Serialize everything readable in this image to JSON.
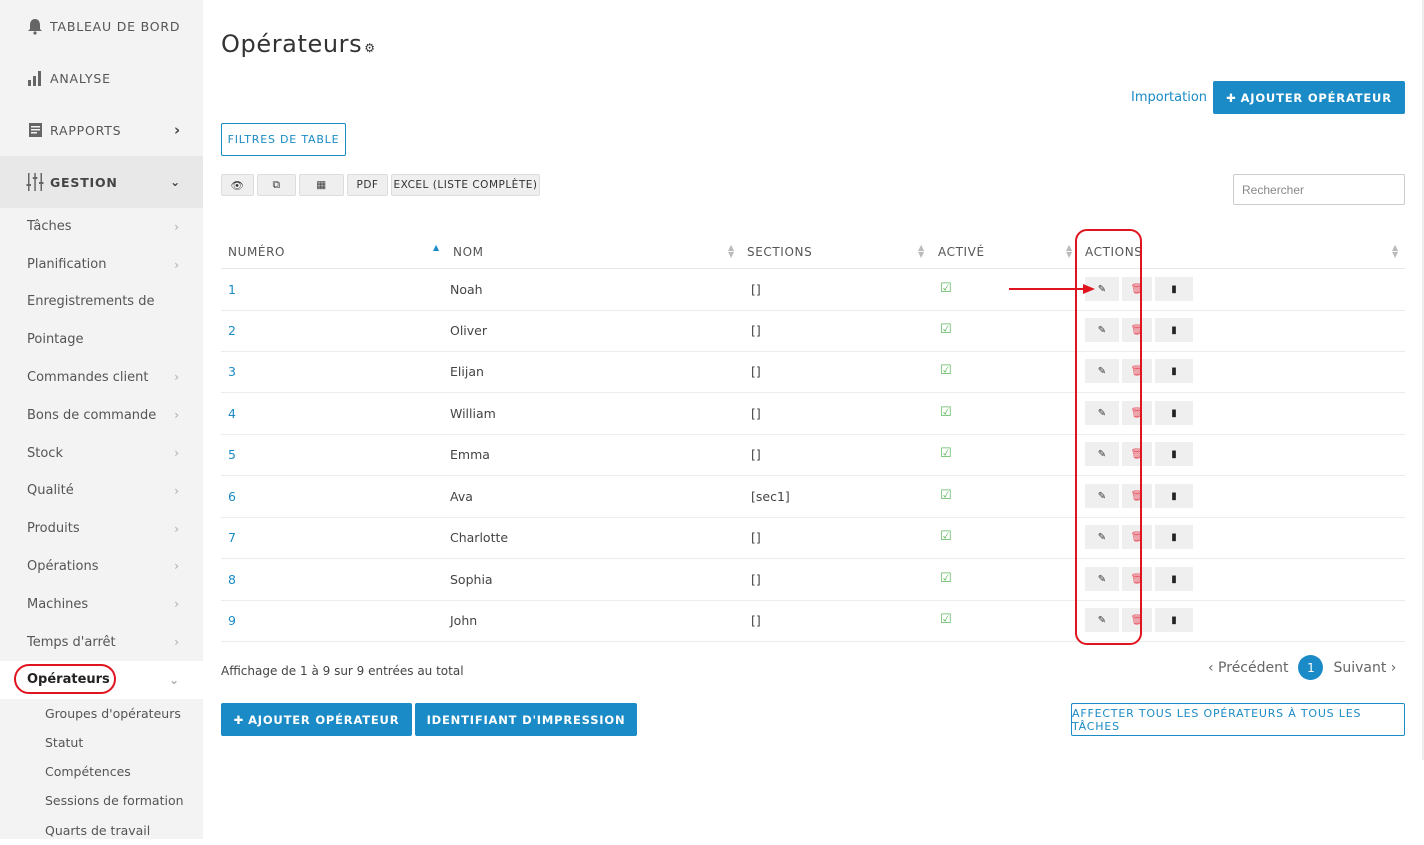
{
  "sidebar": {
    "top": [
      {
        "label": "TABLEAU DE BORD",
        "icon": "bell-icon"
      },
      {
        "label": "ANALYSE",
        "icon": "bar-chart-icon"
      },
      {
        "label": "RAPPORTS",
        "icon": "report-icon"
      }
    ],
    "gestion": "GESTION",
    "items": [
      "Tâches",
      "Planification",
      "Enregistrements de production",
      "Pointage",
      "Commandes client",
      "Bons de commande",
      "Stock",
      "Qualité",
      "Produits",
      "Opérations",
      "Machines",
      "Temps d'arrêt"
    ],
    "active": "Opérateurs",
    "subitems": [
      "Groupes d'opérateurs",
      "Statut",
      "Compétences",
      "Sessions de formation",
      "Quarts de travail"
    ]
  },
  "page": {
    "title": "Opérateurs",
    "import_link": "Importation",
    "add_button": "AJOUTER OPÉRATEUR",
    "filters_button": "FILTRES DE TABLE",
    "tools": [
      "PDF",
      "EXCEL (LISTE COMPLÈTE)"
    ],
    "search_placeholder": "Rechercher"
  },
  "table": {
    "headers": {
      "num": "NUMÉRO",
      "name": "NOM",
      "sections": "SECTIONS",
      "active": "ACTIVÉ",
      "actions": "ACTIONS"
    },
    "rows": [
      {
        "num": "1",
        "name": "Noah",
        "sections": "[]"
      },
      {
        "num": "2",
        "name": "Oliver",
        "sections": "[]"
      },
      {
        "num": "3",
        "name": "Elijan",
        "sections": "[]"
      },
      {
        "num": "4",
        "name": "William",
        "sections": "[]"
      },
      {
        "num": "5",
        "name": "Emma",
        "sections": "[]"
      },
      {
        "num": "6",
        "name": "Ava",
        "sections": "[sec1]"
      },
      {
        "num": "7",
        "name": "Charlotte",
        "sections": "[]"
      },
      {
        "num": "8",
        "name": "Sophia",
        "sections": "[]"
      },
      {
        "num": "9",
        "name": "John",
        "sections": "[]"
      }
    ]
  },
  "footer": {
    "info": "Affichage de 1 à 9 sur 9 entrées au total",
    "prev": "‹ Précédent",
    "page": "1",
    "next": "Suivant ›",
    "add_button": "AJOUTER OPÉRATEUR",
    "print_id": "IDENTIFIANT D'IMPRESSION",
    "assign_all": "AFFECTER TOUS LES OPÉRATEURS À TOUS LES TÂCHES"
  },
  "colors": {
    "accent": "#1a8bc6",
    "highlight": "#e0141e",
    "check": "#5cb85c"
  }
}
